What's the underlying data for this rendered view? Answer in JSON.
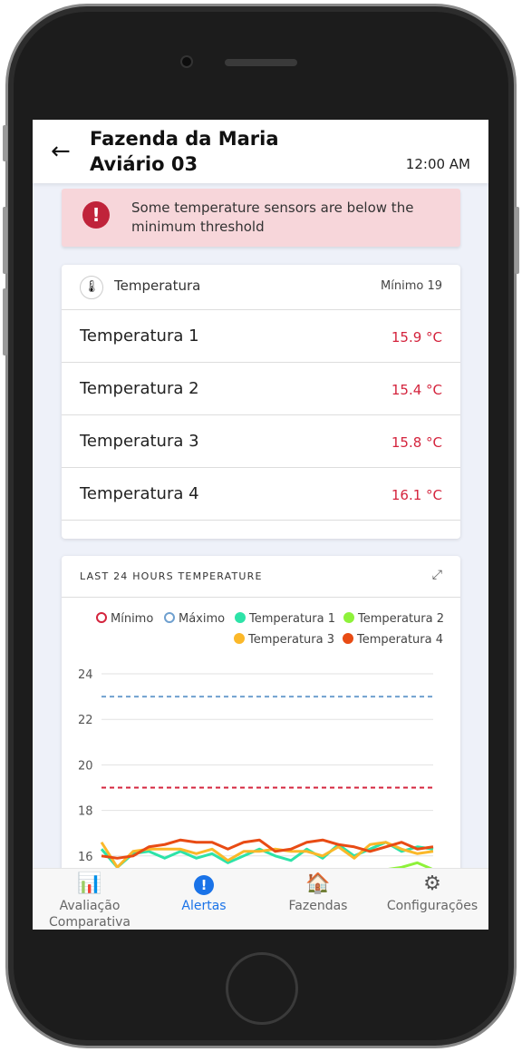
{
  "header": {
    "title_line1": "Fazenda da Maria",
    "title_line2": "Aviário 03",
    "time": "12:00 AM"
  },
  "alert": {
    "message": "Some temperature sensors are below the minimum threshold",
    "color": "#c0233a"
  },
  "sensors": {
    "title": "Temperatura",
    "minimum": "Mínimo 19",
    "items": [
      {
        "name": "Temperatura 1",
        "value": "15.9 °C"
      },
      {
        "name": "Temperatura 2",
        "value": "15.4 °C"
      },
      {
        "name": "Temperatura 3",
        "value": "15.8 °C"
      },
      {
        "name": "Temperatura 4",
        "value": "16.1 °C"
      }
    ]
  },
  "chart_data": {
    "type": "line",
    "title": "LAST 24 HOURS TEMPERATURE",
    "ylim": [
      15,
      24
    ],
    "yticks": [
      "16",
      "18",
      "20",
      "22",
      "24"
    ],
    "grid": true,
    "legend_placement": "top-right",
    "series": [
      {
        "name": "Mínimo",
        "color": "#d4243d",
        "dashed": true,
        "values": [
          19,
          19
        ]
      },
      {
        "name": "Máximo",
        "color": "#6fa0cf",
        "dashed": true,
        "values": [
          23,
          23
        ]
      },
      {
        "name": "Temperatura 1",
        "color": "#2de3a8",
        "values": [
          16.3,
          15.5,
          16.1,
          16.2,
          15.9,
          16.2,
          15.9,
          16.1,
          15.7,
          16.0,
          16.3,
          16.0,
          15.8,
          16.3,
          15.9,
          16.5,
          16.0,
          16.3,
          16.6,
          16.2,
          16.4,
          16.3
        ]
      },
      {
        "name": "Temperatura 2",
        "color": "#8ef23a",
        "values": [
          15.0,
          15.0,
          15.0,
          15.0,
          15.0,
          15.0,
          15.0,
          15.0,
          15.0,
          15.0,
          15.0,
          15.0,
          15.0,
          15.0,
          15.0,
          15.0,
          15.0,
          15.1,
          15.4,
          15.5,
          15.7,
          15.4
        ]
      },
      {
        "name": "Temperatura 3",
        "color": "#fbb829",
        "values": [
          16.6,
          15.5,
          16.2,
          16.3,
          16.3,
          16.3,
          16.1,
          16.3,
          15.8,
          16.2,
          16.2,
          16.3,
          16.2,
          16.2,
          16.0,
          16.4,
          15.9,
          16.5,
          16.6,
          16.3,
          16.1,
          16.2
        ]
      },
      {
        "name": "Temperatura 4",
        "color": "#e84b14",
        "values": [
          16.0,
          15.9,
          16.0,
          16.4,
          16.5,
          16.7,
          16.6,
          16.6,
          16.3,
          16.6,
          16.7,
          16.2,
          16.3,
          16.6,
          16.7,
          16.5,
          16.4,
          16.2,
          16.4,
          16.6,
          16.3,
          16.4
        ]
      }
    ]
  },
  "nav": {
    "items": [
      {
        "label": "Avaliação Comparativa",
        "icon": "report-icon"
      },
      {
        "label": "Alertas",
        "icon": "alert-icon",
        "active": true
      },
      {
        "label": "Fazendas",
        "icon": "farm-icon"
      },
      {
        "label": "Configurações",
        "icon": "gear-icon"
      }
    ],
    "active_color": "#1a73e8"
  }
}
